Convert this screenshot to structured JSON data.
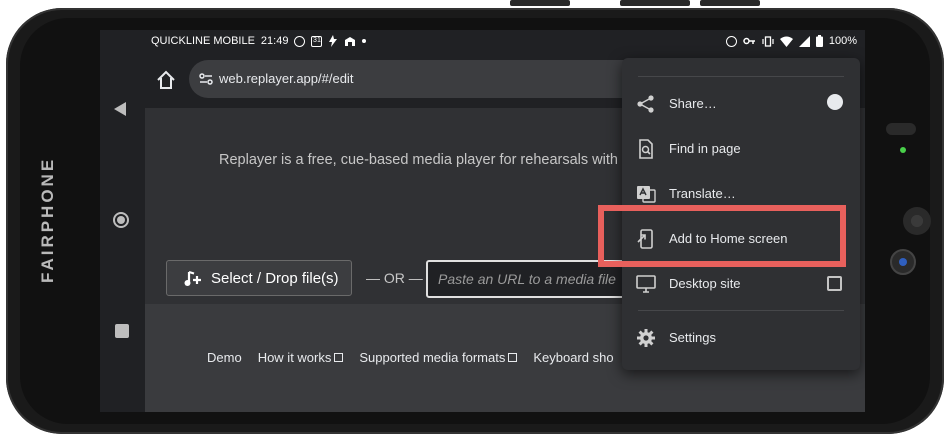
{
  "device": {
    "brand": "FAIRPHONE"
  },
  "status_bar": {
    "carrier": "QUICKLINE MOBILE",
    "time": "21:49",
    "calendar_day": "31",
    "battery": "100%",
    "left_icons": [
      "check-circle-icon",
      "calendar-icon",
      "flash-icon",
      "app-icon",
      "dot-icon"
    ],
    "right_icons": [
      "alarm-icon",
      "key-icon",
      "vibrate-icon",
      "wifi-icon",
      "signal-icon",
      "battery-icon"
    ]
  },
  "browser": {
    "url": "web.replayer.app/#/edit"
  },
  "page": {
    "tagline": "Replayer is a free, cue-based media player for rehearsals with",
    "select_button": "Select / Drop file(s)",
    "separator": "— OR —",
    "url_placeholder": "Paste an URL to a media file",
    "footer_links": [
      "Demo",
      "How it works",
      "Supported media formats",
      "Keyboard sho"
    ]
  },
  "menu": {
    "items": [
      {
        "label": "Share…",
        "icon": "share-icon"
      },
      {
        "label": "Find in page",
        "icon": "find-in-page-icon"
      },
      {
        "label": "Translate…",
        "icon": "translate-icon"
      },
      {
        "label": "Add to Home screen",
        "icon": "add-to-home-icon"
      },
      {
        "label": "Desktop site",
        "icon": "desktop-icon"
      },
      {
        "label": "Settings",
        "icon": "settings-icon"
      }
    ]
  },
  "colors": {
    "highlight": "#e8605c",
    "led": "#49d04a",
    "menu_bg": "#2f3033",
    "page_bg": "#303134"
  }
}
